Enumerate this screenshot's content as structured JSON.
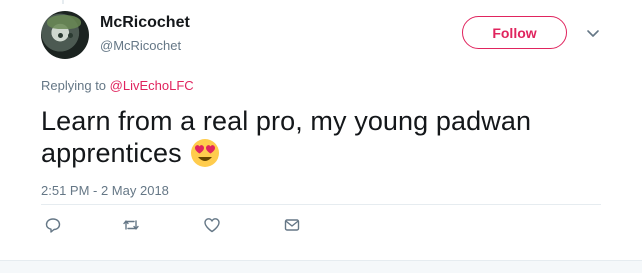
{
  "tweet": {
    "display_name": "McRicochet",
    "username": "@McRicochet",
    "follow_label": "Follow",
    "replying_prefix": "Replying to ",
    "replying_mention": "@LivEchoLFC",
    "text": "Learn from a real pro, my young padwan apprentices",
    "emoji": "heart-eyes-emoji",
    "timestamp": "2:51 PM - 2 May 2018"
  },
  "actions": {
    "reply": "reply-icon",
    "retweet": "retweet-icon",
    "like": "heart-icon",
    "dm": "mail-icon"
  },
  "colors": {
    "accent": "#e0245e",
    "secondary_text": "#657786",
    "divider": "#e6ecf0",
    "text": "#14171a"
  }
}
